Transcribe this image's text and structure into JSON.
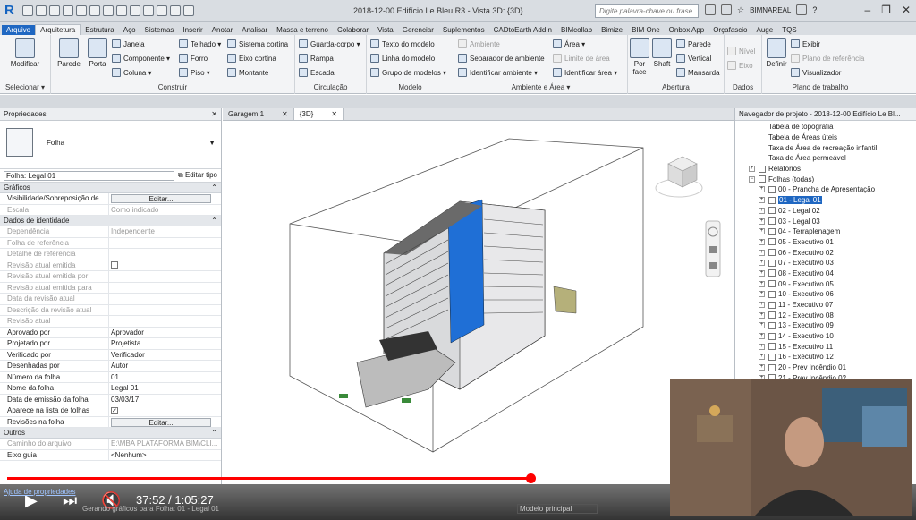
{
  "window": {
    "title": "2018-12-00 Edifício Le Bleu R3 - Vista 3D: {3D}",
    "search_placeholder": "Digite palavra-chave ou frase",
    "user": "BIMNAREAL"
  },
  "tabs": [
    "Arquivo",
    "Arquitetura",
    "Estrutura",
    "Aço",
    "Sistemas",
    "Inserir",
    "Anotar",
    "Analisar",
    "Massa e terreno",
    "Colaborar",
    "Vista",
    "Gerenciar",
    "Suplementos",
    "CADtoEarth AddIn",
    "BIMcollab",
    "Bimize",
    "BIM One",
    "Onbox App",
    "Orçafascio",
    "Auge",
    "TQS"
  ],
  "ribbon": {
    "modificar": "Modificar",
    "selecionar": "Selecionar ▾",
    "parede": "Parede",
    "porta": "Porta",
    "janela": "Janela",
    "componente": "Componente ▾",
    "coluna": "Coluna ▾",
    "telhado": "Telhado ▾",
    "forro": "Forro",
    "piso": "Piso ▾",
    "sistema_cortina": "Sistema cortina",
    "eixo_cortina": "Eixo cortina",
    "montante": "Montante",
    "construir": "Construir",
    "guarda_corpo": "Guarda-corpo ▾",
    "rampa": "Rampa",
    "escada": "Escada",
    "circulacao": "Circulação",
    "texto_modelo": "Texto do modelo",
    "linha_modelo": "Linha do modelo",
    "grupo_modelos": "Grupo de modelos ▾",
    "modelo": "Modelo",
    "ambiente": "Ambiente",
    "separador": "Separador de ambiente",
    "identificar_amb": "Identificar ambiente ▾",
    "area": "Área ▾",
    "limite_area": "Limite de área",
    "identificar_area": "Identificar área ▾",
    "ambiente_area": "Ambiente e Área ▾",
    "por_face": "Por face",
    "shaft": "Shaft",
    "parede2": "Parede",
    "vertical": "Vertical",
    "mansarda": "Mansarda",
    "abertura": "Abertura",
    "nivel": "Nível",
    "eixo": "Eixo",
    "dados": "Dados",
    "definir": "Definir",
    "exibir": "Exibir",
    "plano_ref": "Plano de referência",
    "visualizador": "Visualizador",
    "plano_trabalho": "Plano de trabalho"
  },
  "properties": {
    "title": "Propriedades",
    "type_name": "Folha",
    "selector": "Folha: Legal 01",
    "edit_type": "Editar tipo",
    "sections": [
      {
        "name": "Gráficos",
        "rows": [
          [
            "Visibilidade/Sobreposição de ...",
            "Editar...",
            false,
            "btn"
          ],
          [
            "Escala",
            "Como indicado",
            true,
            ""
          ]
        ]
      },
      {
        "name": "Dados de identidade",
        "rows": [
          [
            "Dependência",
            "Independente",
            true,
            ""
          ],
          [
            "Folha de referência",
            "",
            true,
            ""
          ],
          [
            "Detalhe de referência",
            "",
            true,
            ""
          ],
          [
            "Revisão atual emitida",
            "",
            true,
            "chk0"
          ],
          [
            "Revisão atual emitida por",
            "",
            true,
            ""
          ],
          [
            "Revisão atual emitida para",
            "",
            true,
            ""
          ],
          [
            "Data da revisão atual",
            "",
            true,
            ""
          ],
          [
            "Descrição da revisão atual",
            "",
            true,
            ""
          ],
          [
            "Revisão atual",
            "",
            true,
            ""
          ],
          [
            "Aprovado por",
            "Aprovador",
            false,
            ""
          ],
          [
            "Projetado por",
            "Projetista",
            false,
            ""
          ],
          [
            "Verificado por",
            "Verificador",
            false,
            ""
          ],
          [
            "Desenhadas por",
            "Autor",
            false,
            ""
          ],
          [
            "Número da folha",
            "01",
            false,
            ""
          ],
          [
            "Nome da folha",
            "Legal 01",
            false,
            ""
          ],
          [
            "Data de emissão da folha",
            "03/03/17",
            false,
            ""
          ],
          [
            "Aparece na lista de folhas",
            "",
            false,
            "chk1"
          ],
          [
            "Revisões na folha",
            "Editar...",
            false,
            "btn"
          ]
        ]
      },
      {
        "name": "Outros",
        "rows": [
          [
            "Caminho do arquivo",
            "E:\\MBA PLATAFORMA BIM\\CLI...",
            true,
            ""
          ],
          [
            "Eixo guia",
            "<Nenhum>",
            false,
            ""
          ]
        ]
      }
    ],
    "help_link": "Ajuda de propriedades"
  },
  "view_tabs": [
    {
      "label": "Garagem 1"
    },
    {
      "label": "{3D}"
    }
  ],
  "browser": {
    "title": "Navegador de projeto - 2018-12-00 Edifício Le Bl...",
    "items": [
      {
        "label": "Tabela de topografia",
        "indent": 3,
        "pm": ""
      },
      {
        "label": "Tabela de Áreas úteis",
        "indent": 3,
        "pm": ""
      },
      {
        "label": "Taxa de Área de recreação infantil",
        "indent": 3,
        "pm": ""
      },
      {
        "label": "Taxa de Área permeável",
        "indent": 3,
        "pm": ""
      },
      {
        "label": "Relatórios",
        "indent": 1,
        "pm": "+"
      },
      {
        "label": "Folhas (todas)",
        "indent": 1,
        "pm": "−"
      },
      {
        "label": "00 - Prancha de Apresentação",
        "indent": 2,
        "pm": "+"
      },
      {
        "label": "01 - Legal 01",
        "indent": 2,
        "pm": "+",
        "sel": true
      },
      {
        "label": "02 - Legal 02",
        "indent": 2,
        "pm": "+"
      },
      {
        "label": "03 - Legal 03",
        "indent": 2,
        "pm": "+"
      },
      {
        "label": "04 - Terraplenagem",
        "indent": 2,
        "pm": "+"
      },
      {
        "label": "05 - Executivo 01",
        "indent": 2,
        "pm": "+"
      },
      {
        "label": "06 - Executivo 02",
        "indent": 2,
        "pm": "+"
      },
      {
        "label": "07 - Executivo 03",
        "indent": 2,
        "pm": "+"
      },
      {
        "label": "08 - Executivo 04",
        "indent": 2,
        "pm": "+"
      },
      {
        "label": "09 - Executivo 05",
        "indent": 2,
        "pm": "+"
      },
      {
        "label": "10 - Executivo 06",
        "indent": 2,
        "pm": "+"
      },
      {
        "label": "11 - Executivo 07",
        "indent": 2,
        "pm": "+"
      },
      {
        "label": "12 - Executivo 08",
        "indent": 2,
        "pm": "+"
      },
      {
        "label": "13 - Executivo 09",
        "indent": 2,
        "pm": "+"
      },
      {
        "label": "14 - Executivo 10",
        "indent": 2,
        "pm": "+"
      },
      {
        "label": "15 - Executivo 11",
        "indent": 2,
        "pm": "+"
      },
      {
        "label": "16 - Executivo 12",
        "indent": 2,
        "pm": "+"
      },
      {
        "label": "20 - Prev Incêndio 01",
        "indent": 2,
        "pm": "+"
      },
      {
        "label": "21 - Prev Incêndio 02",
        "indent": 2,
        "pm": "+"
      }
    ]
  },
  "status": {
    "message": "Gerando gráficos para Folha: 01 - Legal 01",
    "model": "Modelo principal"
  },
  "video": {
    "time": "37:52 / 1:05:27",
    "progress": 0.58
  }
}
